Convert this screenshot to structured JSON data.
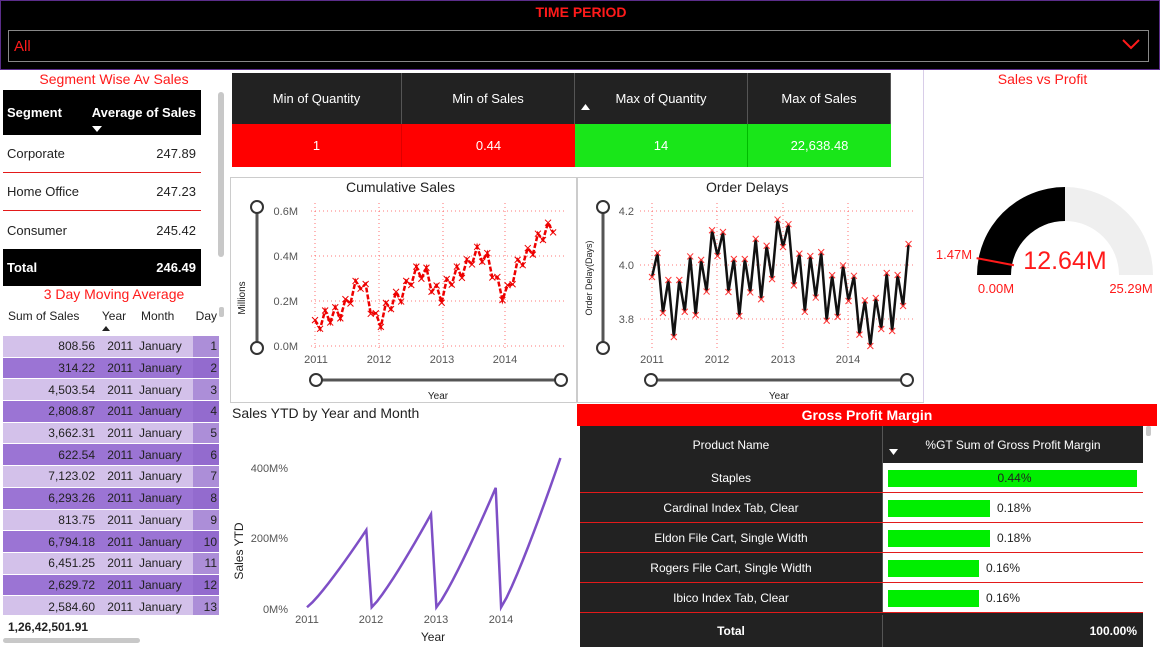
{
  "time_period": {
    "title": "TIME PERIOD",
    "value": "All"
  },
  "segment": {
    "title": "Segment Wise Av Sales",
    "col1": "Segment",
    "col2": "Average of Sales",
    "rows": [
      {
        "name": "Corporate",
        "value": "247.89"
      },
      {
        "name": "Home Office",
        "value": "247.23"
      },
      {
        "name": "Consumer",
        "value": "245.42"
      }
    ],
    "total_label": "Total",
    "total_value": "246.49"
  },
  "moving_avg": {
    "title": "3 Day Moving Average",
    "headers": [
      "Sum of Sales",
      "Year",
      "Month",
      "Day"
    ],
    "rows": [
      [
        "808.56",
        "2011",
        "January",
        "1"
      ],
      [
        "314.22",
        "2011",
        "January",
        "2"
      ],
      [
        "4,503.54",
        "2011",
        "January",
        "3"
      ],
      [
        "2,808.87",
        "2011",
        "January",
        "4"
      ],
      [
        "3,662.31",
        "2011",
        "January",
        "5"
      ],
      [
        "622.54",
        "2011",
        "January",
        "6"
      ],
      [
        "7,123.02",
        "2011",
        "January",
        "7"
      ],
      [
        "6,293.26",
        "2011",
        "January",
        "8"
      ],
      [
        "813.75",
        "2011",
        "January",
        "9"
      ],
      [
        "6,794.18",
        "2011",
        "January",
        "10"
      ],
      [
        "6,451.25",
        "2011",
        "January",
        "11"
      ],
      [
        "2,629.72",
        "2011",
        "January",
        "12"
      ],
      [
        "2,584.60",
        "2011",
        "January",
        "13"
      ]
    ],
    "total": "1,26,42,501.91"
  },
  "kpi": {
    "headers": [
      "Min of Quantity",
      "Min of Sales",
      "Max of Quantity",
      "Max of Sales"
    ],
    "values": [
      "1",
      "0.44",
      "14",
      "22,638.48"
    ],
    "colors": [
      "#ff0000",
      "#ff0000",
      "#19e619",
      "#19e619"
    ]
  },
  "cumulative": {
    "title": "Cumulative Sales",
    "ylabel": "Millions",
    "xlabel": "Year",
    "yticks": [
      "0.6M",
      "0.4M",
      "0.2M",
      "0.0M"
    ],
    "xticks": [
      "2011",
      "2012",
      "2013",
      "2014"
    ]
  },
  "delays": {
    "title": "Order Delays",
    "ylabel": "Order Delay(Days)",
    "xlabel": "Year",
    "yticks": [
      "4.2",
      "4.0",
      "3.8"
    ],
    "xticks": [
      "2011",
      "2012",
      "2013",
      "2014"
    ]
  },
  "ytd": {
    "title": "Sales YTD by Year and Month",
    "ylabel": "Sales YTD",
    "xlabel": "Year",
    "yticks": [
      "400M%",
      "200M%",
      "0M%"
    ],
    "xticks": [
      "2011",
      "2012",
      "2013",
      "2014"
    ]
  },
  "gauge": {
    "title": "Sales vs Profit",
    "value": "12.64M",
    "min": "0.00M",
    "max": "25.29M",
    "target": "1.47M",
    "fill_fraction": 0.5
  },
  "gpm": {
    "title": "Gross Profit Margin",
    "col1": "Product Name",
    "col2": "%GT Sum of Gross Profit Margin",
    "rows": [
      {
        "name": "Staples",
        "pct": "0.44%",
        "value": 0.44
      },
      {
        "name": "Cardinal Index Tab, Clear",
        "pct": "0.18%",
        "value": 0.18
      },
      {
        "name": "Eldon File Cart, Single Width",
        "pct": "0.18%",
        "value": 0.18
      },
      {
        "name": "Rogers File Cart, Single Width",
        "pct": "0.16%",
        "value": 0.16
      },
      {
        "name": "Ibico Index Tab, Clear",
        "pct": "0.16%",
        "value": 0.16
      }
    ],
    "total_label": "Total",
    "total_value": "100.00%"
  },
  "chart_data": [
    {
      "type": "line",
      "title": "Cumulative Sales",
      "xlabel": "Year",
      "ylabel": "Millions",
      "ylim": [
        0,
        0.6
      ],
      "x": [
        "2011-01",
        "2011-04",
        "2011-07",
        "2011-10",
        "2012-01",
        "2012-04",
        "2012-07",
        "2012-10",
        "2013-01",
        "2013-04",
        "2013-07",
        "2013-10",
        "2014-01",
        "2014-04",
        "2014-07",
        "2014-10"
      ],
      "series": [
        {
          "values": [
            0.1,
            0.12,
            0.2,
            0.28,
            0.1,
            0.2,
            0.3,
            0.32,
            0.22,
            0.33,
            0.4,
            0.38,
            0.2,
            0.4,
            0.45,
            0.55
          ]
        }
      ]
    },
    {
      "type": "line",
      "title": "Order Delays",
      "xlabel": "Year",
      "ylabel": "Order Delay(Days)",
      "ylim": [
        3.75,
        4.2
      ],
      "x": [
        "2011-01",
        "2011-06",
        "2012-01",
        "2012-06",
        "2013-01",
        "2013-06",
        "2014-01",
        "2014-06",
        "2014-12"
      ],
      "series": [
        {
          "values": [
            3.98,
            3.88,
            4.05,
            3.95,
            4.08,
            3.96,
            3.9,
            3.82,
            3.98
          ]
        }
      ]
    },
    {
      "type": "line",
      "title": "Sales YTD by Year and Month",
      "xlabel": "Year",
      "ylabel": "Sales YTD",
      "ylim": [
        0,
        450
      ],
      "x": [
        "2011-01",
        "2011-12",
        "2012-01",
        "2012-12",
        "2013-01",
        "2013-12",
        "2014-01",
        "2014-12"
      ],
      "series": [
        {
          "values": [
            5,
            225,
            5,
            270,
            5,
            345,
            5,
            430
          ]
        }
      ]
    }
  ]
}
